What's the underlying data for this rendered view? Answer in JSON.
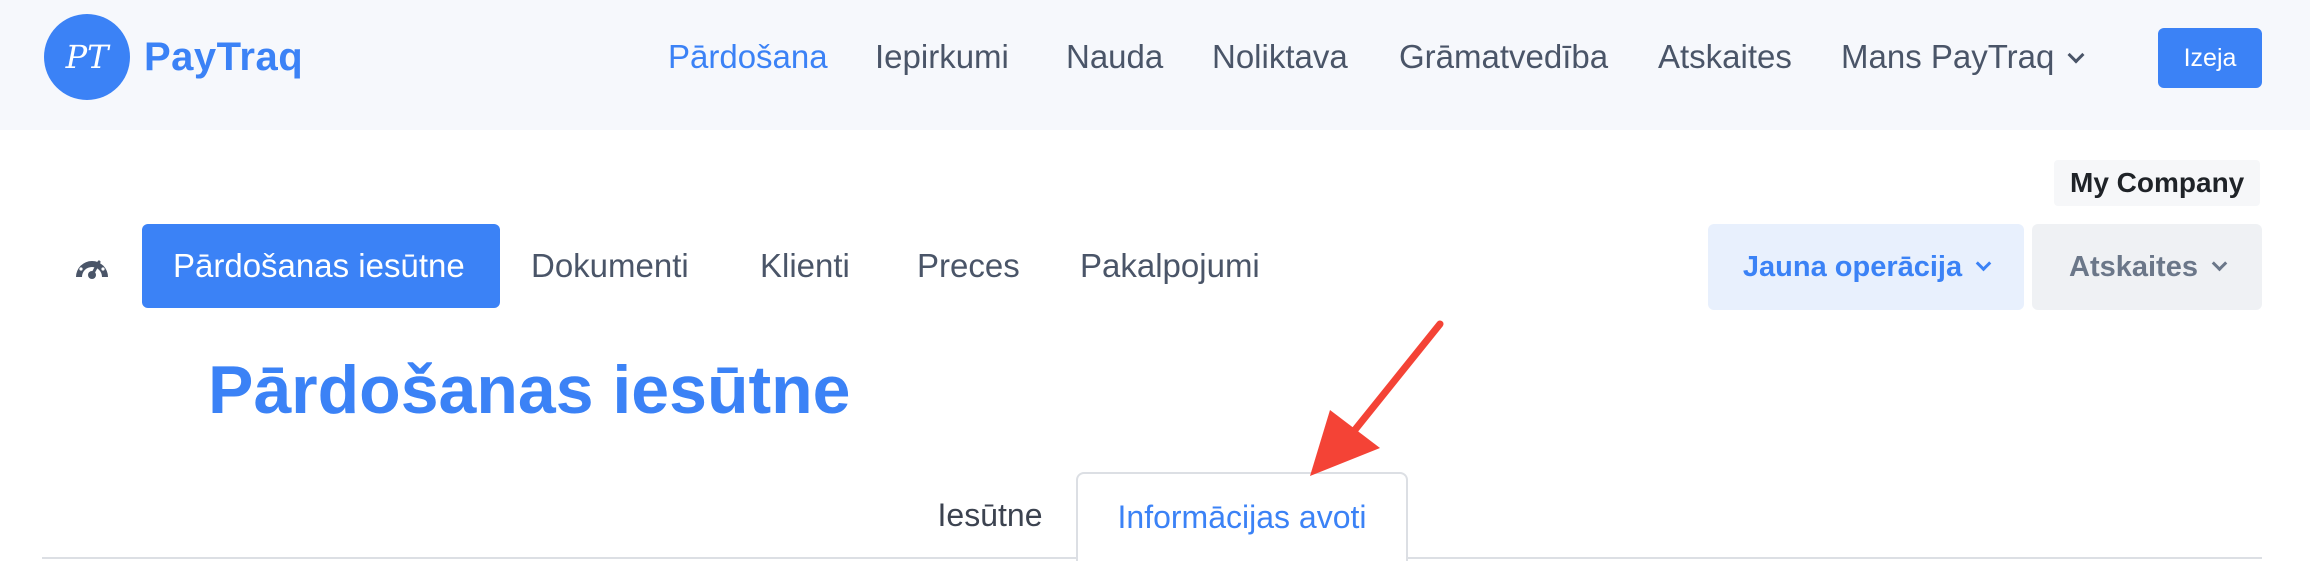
{
  "header": {
    "logo": {
      "monogram": "PT",
      "brand": "PayTraq",
      "brand_color": "#3b82f6"
    },
    "nav": [
      {
        "label": "Pārdošana",
        "active": true
      },
      {
        "label": "Iepirkumi",
        "active": false
      },
      {
        "label": "Nauda",
        "active": false
      },
      {
        "label": "Noliktava",
        "active": false
      },
      {
        "label": "Grāmatvedība",
        "active": false
      },
      {
        "label": "Atskaites",
        "active": false
      },
      {
        "label": "Mans PayTraq",
        "active": false,
        "icon": "chevron-down-icon"
      }
    ],
    "exit_label": "Izeja"
  },
  "company_name": "My Company",
  "subnav": {
    "dashboard_icon": "speedometer-icon",
    "items": [
      {
        "label": "Pārdošanas iesūtne",
        "active": true
      },
      {
        "label": "Dokumenti",
        "active": false
      },
      {
        "label": "Klienti",
        "active": false
      },
      {
        "label": "Preces",
        "active": false
      },
      {
        "label": "Pakalpojumi",
        "active": false
      }
    ],
    "new_operation_label": "Jauna operācija",
    "reports_label": "Atskaites"
  },
  "page": {
    "title": "Pārdošanas iesūtne",
    "tabs": [
      {
        "label": "Iesūtne",
        "active": false
      },
      {
        "label": "Informācijas avoti",
        "active": true
      }
    ]
  },
  "annotation": {
    "type": "arrow",
    "color": "#f44336",
    "points_to": "Informācijas avoti"
  },
  "colors": {
    "accent": "#3b82f6",
    "header_bg": "#f6f8fc",
    "text": "#4a5568"
  }
}
